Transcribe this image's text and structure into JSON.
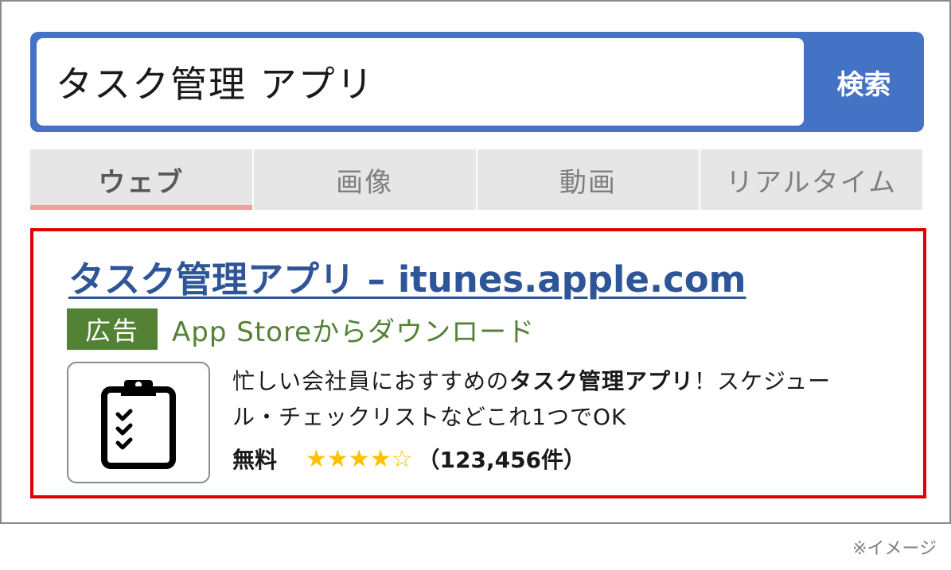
{
  "search": {
    "query": "タスク管理 アプリ",
    "button_label": "検索"
  },
  "tabs": [
    {
      "label": "ウェブ",
      "active": true
    },
    {
      "label": "画像",
      "active": false
    },
    {
      "label": "動画",
      "active": false
    },
    {
      "label": "リアルタイム",
      "active": false
    }
  ],
  "ad": {
    "title": "タスク管理アプリ – itunes.apple.com",
    "badge": "広告",
    "subtitle": "App Storeからダウンロード",
    "icon": "clipboard-checklist-icon",
    "description_before": "忙しい会社員におすすめの",
    "description_bold": "タスク管理アプリ",
    "description_after": "！スケジュール・チェックリストなどこれ1つでOK",
    "price": "無料",
    "rating": 4,
    "rating_max": 5,
    "stars_text": "★★★★☆",
    "reviews": "（123,456件）"
  },
  "caption": "※イメージ",
  "colors": {
    "search_accent": "#4472c4",
    "tab_active_underline": "#ff9b9b",
    "ad_border": "#e00000",
    "title_link": "#2e5597",
    "badge_green": "#548235",
    "star_gold": "#ffc000"
  }
}
